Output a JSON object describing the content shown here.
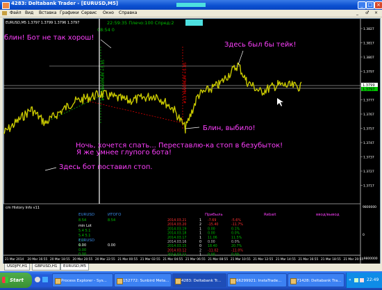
{
  "window": {
    "title": "4283: Deltabank Trader - [EURUSD,M5]",
    "controls": [
      "_",
      "□",
      "×"
    ]
  },
  "menu": {
    "items": [
      "Файл",
      "Вид",
      "Вставка",
      "Графики",
      "Сервис",
      "Окно",
      "Справка"
    ],
    "controls": [
      "_",
      "♂",
      "×"
    ]
  },
  "chart": {
    "header": "EURUSD,M5  1.3797 1.3799 1.3796 1.3797",
    "info_green_1": "22:59:35 Плечо:100 Спред:2",
    "info_green_2": "08:54   0",
    "price_labels": [
      "1.3827",
      "1.3817",
      "1.3807",
      "1.3797",
      "1.3787",
      "1.3777",
      "1.3767",
      "1.3757",
      "1.3747",
      "1.3737",
      "1.3727",
      "1.3717"
    ],
    "current_price_1": "1.3799",
    "current_price_2": "1.3797",
    "indicator_scale": [
      "9800000",
      "0",
      "-9800000"
    ],
    "time_labels": [
      "21 Mar 2014",
      "20 Mar 16:55",
      "20 Mar 18:55",
      "20 Mar 20:55",
      "20 Mar 22:55",
      "21 Mar 00:55",
      "21 Mar 02:55",
      "21 Mar 04:55",
      "21 Mar 06:55",
      "21 Mar 08:55",
      "21 Mar 10:55",
      "21 Mar 12:55",
      "21 Mar 14:55",
      "21 Mar 16:55",
      "21 Mar 18:55",
      "21 Mar 20:55"
    ],
    "annotations": {
      "top_left": "блин! Бот не так хорош!",
      "take": "Здесь был бы тейк!",
      "stopped": "Блин, выбило!",
      "night": "Ночь, хочется спать... Переставлю-ка стоп в безубыток!",
      "smarter": "Я же умнее глупого бота!",
      "stop_set": "Здесь бот поставил стоп."
    },
    "vertical_labels": {
      "green": "#14 MAXIMUM +5.85",
      "red": "#13 MAXIMUM +5.85"
    },
    "colors": {
      "price_line": "#c8c800",
      "buy_line": "#00c000",
      "sell_line": "#ff0000",
      "annotation": "#ff40ff",
      "hline": "#808080"
    }
  },
  "indicator": {
    "title": "cm History Info v11",
    "eurusd_label_1": "EURUSD",
    "itogo": "ИТОГО",
    "left_values": [
      "8.54",
      "min  Lot",
      "5.4    5.1",
      "5.4    5.1",
      "1.1",
      "1.0",
      "EURUSD",
      "0.00",
      "0.00",
      "0.00"
    ],
    "itogo_values": [
      "8.54",
      "0.00"
    ],
    "profit_header": "Прибыль",
    "rebate_header": "Rebait",
    "deposit_header": "ввод/вывод",
    "rows": [
      {
        "date": "2014.03.21",
        "num": "1",
        "profit": "-7.69",
        "pct": "-5.6%",
        "color": "#ff3030"
      },
      {
        "date": "2014.03.20",
        "num": "2",
        "profit": "-15.40",
        "pct": "-11.7%",
        "color": "#ff3030"
      },
      {
        "date": "2014.03.19",
        "num": "1",
        "profit": "0.00",
        "pct": "0.1%",
        "color": "#00c000"
      },
      {
        "date": "2014.03.18",
        "num": "1",
        "profit": "0.00",
        "pct": "0.0%",
        "color": "#00c000"
      },
      {
        "date": "2014.03.17",
        "num": "1",
        "profit": "11.06",
        "pct": "11.5%",
        "color": "#00c000"
      },
      {
        "date": "2014.03.16",
        "num": "0",
        "profit": "0.00",
        "pct": "0.0%",
        "color": "#c0c0c0"
      },
      {
        "date": "2014.03.15",
        "num": "0",
        "profit": "18.40",
        "pct": "20.7%",
        "color": "#00c000"
      },
      {
        "date": "2014.03.12",
        "num": "2",
        "profit": "-11.02",
        "pct": "-11.0%",
        "color": "#ff3030"
      },
      {
        "date": "2014.03.11",
        "num": "1",
        "profit": "0.00",
        "pct": "0.0%",
        "color": "#00c000"
      }
    ]
  },
  "tabs": [
    "USDJPY,H1",
    "GBPUSD,H1",
    "EURUSD,M5"
  ],
  "taskbar": {
    "start": "Start",
    "tasks": [
      "Process Explorer - Sys...",
      "152772: Sunbird Meta...",
      "4283: Deltabank Tr...",
      "66299921: InstaTrade...",
      "71428: Deltabank Tra..."
    ],
    "clock": "22:49"
  }
}
